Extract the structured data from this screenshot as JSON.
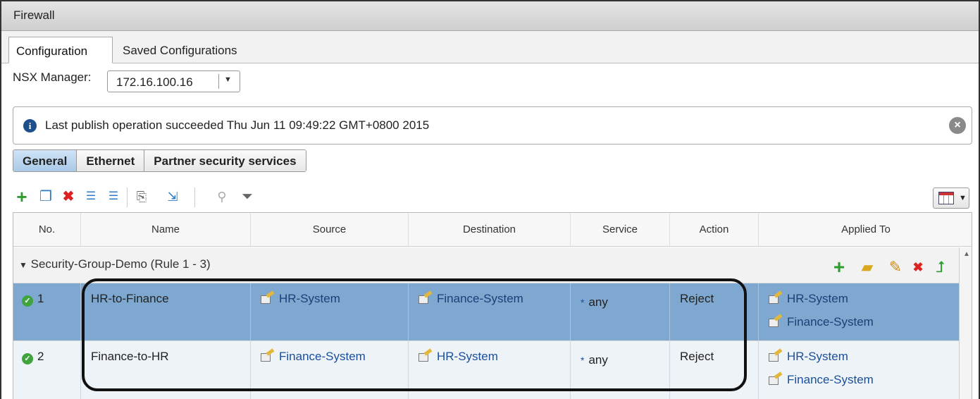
{
  "window": {
    "title": "Firewall"
  },
  "tabs": [
    {
      "label": "Configuration",
      "active": true
    },
    {
      "label": "Saved Configurations",
      "active": false
    }
  ],
  "nsx_manager": {
    "label": "NSX Manager:",
    "value": "172.16.100.16"
  },
  "notice": {
    "message": "Last publish operation succeeded Thu Jun 11 09:49:22 GMT+0800 2015",
    "icon": "info-icon",
    "close_icon": "close-circle-icon"
  },
  "subtabs": [
    {
      "label": "General",
      "active": true
    },
    {
      "label": "Ethernet",
      "active": false
    },
    {
      "label": "Partner security services",
      "active": false
    }
  ],
  "toolbar": {
    "icons": [
      "add-rule-icon",
      "copy-rule-icon",
      "delete-rule-icon",
      "move-up-icon",
      "move-down-icon",
      "paste-rule-icon",
      "export-icon",
      "clear-filter-icon",
      "filter-icon"
    ],
    "columns_icon": "columns-icon"
  },
  "table": {
    "columns": [
      "No.",
      "Name",
      "Source",
      "Destination",
      "Service",
      "Action",
      "Applied To"
    ],
    "section": {
      "label": "Security-Group-Demo (Rule 1 - 3)",
      "icons": [
        "add-icon",
        "add-section-icon",
        "edit-icon",
        "delete-icon",
        "move-up-icon"
      ]
    },
    "rows": [
      {
        "no": "1",
        "name": "HR-to-Finance",
        "source": "HR-System",
        "destination": "Finance-System",
        "service": "any",
        "action": "Reject",
        "applied_to": [
          "HR-System",
          "Finance-System"
        ],
        "selected": true
      },
      {
        "no": "2",
        "name": "Finance-to-HR",
        "source": "Finance-System",
        "destination": "HR-System",
        "service": "any",
        "action": "Reject",
        "applied_to": [
          "HR-System",
          "Finance-System"
        ],
        "selected": false
      }
    ]
  },
  "colors": {
    "selected_row": "#7ea8cf",
    "link": "#1a4f9c",
    "status_ok": "#3ea43e",
    "delete": "#dd2222"
  }
}
